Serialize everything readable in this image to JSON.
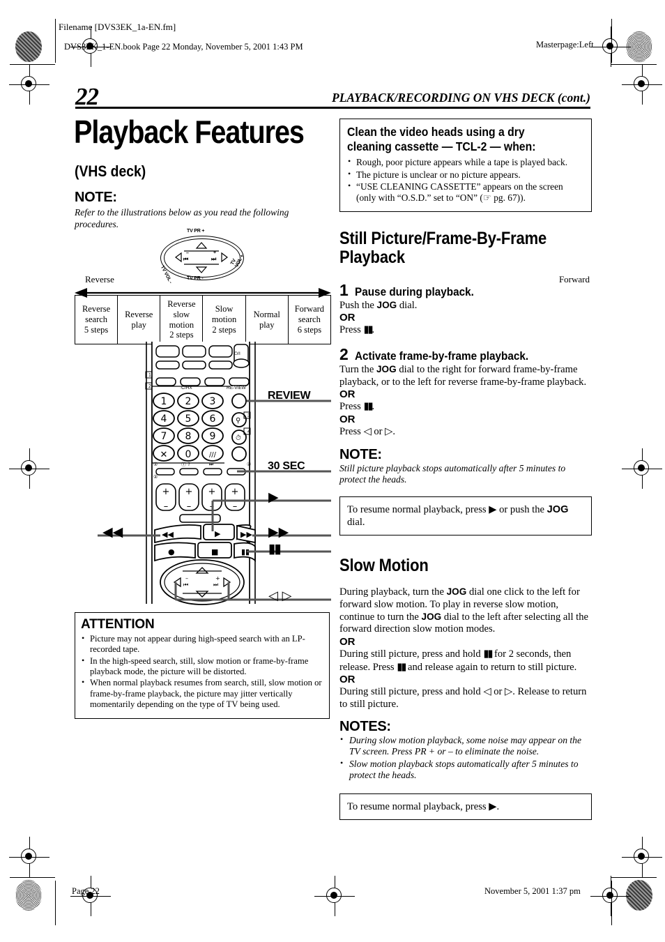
{
  "printmarks": {
    "filename": "Filename [DVS3EK_1a-EN.fm]",
    "book_line": "DVS3EK_1-EN.book  Page 22  Monday, November 5, 2001  1:43 PM",
    "masterpage": "Masterpage:Left",
    "footer_page": "Page 22",
    "footer_date": "November 5, 2001 1:37 pm"
  },
  "header": {
    "page_number": "22",
    "running_head": "PLAYBACK/RECORDING ON VHS DECK (cont.)"
  },
  "left_column": {
    "title": "Playback Features",
    "subtitle": "(VHS deck)",
    "note_heading": "NOTE:",
    "note_body": "Refer to the illustrations below as you read the following procedures.",
    "jog_dial": {
      "top_label": "TV PR +",
      "bottom_label": "TV PR -",
      "left_label": "TV VOL -",
      "right_label": "TV VOL +",
      "minus": "–",
      "plus": "+",
      "skip_back": "⏮",
      "skip_fwd": "⏭",
      "left_arrow": "◁",
      "right_arrow": "▷",
      "up_arrow": "△",
      "down_arrow": "▽"
    },
    "direction_left": "Reverse",
    "direction_right": "Forward",
    "modes_table": {
      "cells": [
        "Reverse\nsearch\n5 steps",
        "Reverse\nplay",
        "Reverse\nslow\nmotion\n2 steps",
        "Slow\nmotion\n2 steps",
        "Normal\nplay",
        "Forward\nsearch\n6 steps"
      ]
    },
    "remote_callouts": [
      {
        "label": "REVIEW",
        "kind": "text"
      },
      {
        "label": "30 SEC",
        "kind": "text"
      },
      {
        "label": "▶",
        "kind": "glyph"
      },
      {
        "label": "▶▶",
        "kind": "glyph"
      },
      {
        "label": "▮▮",
        "kind": "glyph"
      },
      {
        "label": "◀◀",
        "kind": "glyph"
      },
      {
        "label": "◁ ▷",
        "kind": "glyph"
      }
    ],
    "remote_keys": {
      "numbers": [
        "1",
        "2",
        "3",
        "4",
        "5",
        "6",
        "7",
        "8",
        "9",
        "0"
      ],
      "power": "⏻/I",
      "cancel": "✕",
      "c_hx": "C/HX",
      "review_print": "RE-VIEW",
      "plus_minus": [
        "+",
        "–"
      ],
      "transport": [
        "◀◀",
        "▶",
        "▶▶",
        "●",
        "■",
        "▮▮"
      ]
    },
    "attention": {
      "heading": "ATTENTION",
      "items": [
        "Picture may not appear during high-speed search with an LP-recorded tape.",
        "In the high-speed search, still, slow motion or frame-by-frame playback mode, the picture will be distorted.",
        "When normal playback resumes from search, still, slow motion or frame-by-frame playback, the picture may jitter vertically momentarily depending on the type of TV being used."
      ]
    }
  },
  "right_column": {
    "cleaning_box": {
      "heading": "Clean the video heads using a dry cleaning cassette — TCL-2 — when:",
      "items": [
        "Rough, poor picture appears while a tape is played back.",
        "The picture is unclear or no picture appears.",
        "“USE CLEANING CASSETTE” appears on the screen (only with “O.S.D.” set to “ON” (☞ pg. 67))."
      ]
    },
    "still_picture": {
      "heading": "Still Picture/Frame-By-Frame Playback",
      "step1": {
        "num": "1",
        "title": "Pause during playback.",
        "lines": [
          {
            "type": "body",
            "text": "Push the JOG dial."
          },
          {
            "type": "or",
            "text": "OR"
          },
          {
            "type": "body",
            "text": "Press ▮▮."
          }
        ]
      },
      "step2": {
        "num": "2",
        "title": "Activate frame-by-frame playback.",
        "lines": [
          {
            "type": "body",
            "text": "Turn the JOG dial to the right for forward frame-by-frame playback, or to the left for reverse frame-by-frame playback."
          },
          {
            "type": "or",
            "text": "OR"
          },
          {
            "type": "body",
            "text": "Press ▮▮."
          },
          {
            "type": "or",
            "text": "OR"
          },
          {
            "type": "body",
            "text": "Press ◁ or ▷."
          }
        ]
      },
      "note_heading": "NOTE:",
      "note_body": "Still picture playback stops automatically after 5 minutes to protect the heads.",
      "tip": "To resume normal playback, press ▶ or push the JOG dial."
    },
    "slow_motion": {
      "heading": "Slow Motion",
      "paragraphs": [
        {
          "type": "body",
          "text": "During playback, turn the JOG dial one click to the left for forward slow motion. To play in reverse slow motion, continue to turn the JOG dial to the left after selecting all the forward direction slow motion modes."
        },
        {
          "type": "or",
          "text": "OR"
        },
        {
          "type": "body",
          "text": "During still picture, press and hold ▮▮ for 2 seconds, then release. Press ▮▮ and release again to return to still picture."
        },
        {
          "type": "or",
          "text": "OR"
        },
        {
          "type": "body",
          "text": "During still picture, press and hold ◁ or ▷. Release to return to still picture."
        }
      ],
      "notes_heading": "NOTES:",
      "notes": [
        "During slow motion playback, some noise may appear on the TV screen. Press PR + or – to eliminate the noise.",
        "Slow motion playback stops automatically after 5 minutes to protect the heads."
      ],
      "tip": "To resume normal playback, press ▶."
    }
  }
}
